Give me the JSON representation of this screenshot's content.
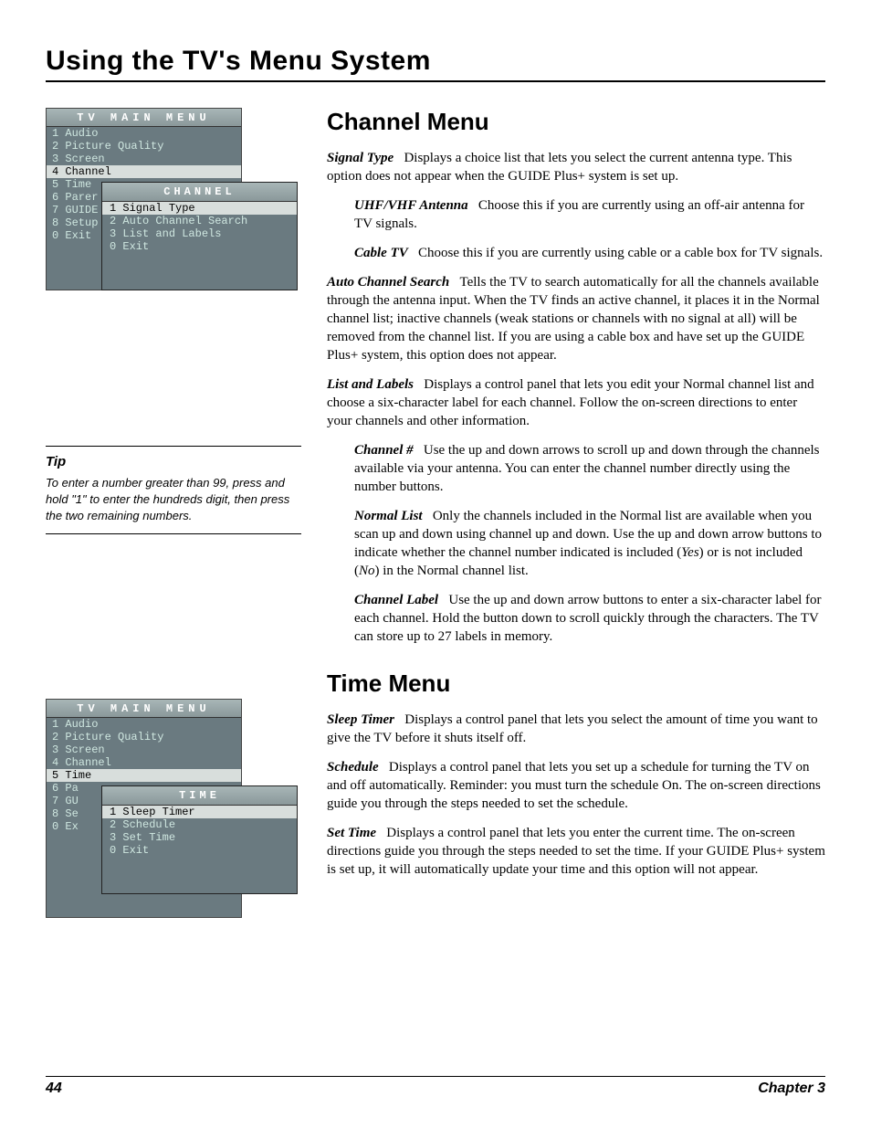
{
  "header": "Using the TV's Menu System",
  "footer": {
    "page": "44",
    "chapter": "Chapter 3"
  },
  "figure1": {
    "main_title": "TV MAIN MENU",
    "items": [
      {
        "n": "1",
        "l": "Audio"
      },
      {
        "n": "2",
        "l": "Picture Quality"
      },
      {
        "n": "3",
        "l": "Screen"
      },
      {
        "n": "4",
        "l": "Channel"
      },
      {
        "n": "5",
        "l": "Time"
      },
      {
        "n": "6",
        "l": "Parer"
      },
      {
        "n": "7",
        "l": "GUIDE"
      },
      {
        "n": "8",
        "l": "Setup"
      },
      {
        "n": "0",
        "l": "Exit"
      }
    ],
    "sub_title": "CHANNEL",
    "sub_items": [
      {
        "n": "1",
        "l": "Signal Type"
      },
      {
        "n": "2",
        "l": "Auto Channel Search"
      },
      {
        "n": "3",
        "l": "List and Labels"
      },
      {
        "n": "0",
        "l": "Exit"
      }
    ]
  },
  "tip": {
    "heading": "Tip",
    "text": "To enter a number greater than 99, press and hold \"1\" to enter the hundreds digit, then press the two remaining numbers."
  },
  "figure2": {
    "main_title": "TV MAIN MENU",
    "items": [
      {
        "n": "1",
        "l": "Audio"
      },
      {
        "n": "2",
        "l": "Picture Quality"
      },
      {
        "n": "3",
        "l": "Screen"
      },
      {
        "n": "4",
        "l": "Channel"
      },
      {
        "n": "5",
        "l": "Time"
      },
      {
        "n": "6",
        "l": "Pa"
      },
      {
        "n": "7",
        "l": "GU"
      },
      {
        "n": "8",
        "l": "Se"
      },
      {
        "n": "0",
        "l": "Ex"
      }
    ],
    "sub_title": "TIME",
    "sub_items": [
      {
        "n": "1",
        "l": "Sleep Timer"
      },
      {
        "n": "2",
        "l": "Schedule"
      },
      {
        "n": "3",
        "l": "Set Time"
      },
      {
        "n": "0",
        "l": "Exit"
      }
    ]
  },
  "channel_menu": {
    "title": "Channel Menu",
    "signal_type": {
      "term": "Signal Type",
      "text": "Displays a choice list that lets you select the current antenna type. This option does not appear when the GUIDE Plus+ system is set up."
    },
    "uhf": {
      "term": "UHF/VHF Antenna",
      "text": "Choose this if you are currently using an off-air antenna for TV signals."
    },
    "cable": {
      "term": "Cable TV",
      "text": "Choose this if you are currently using cable or a cable box for TV signals."
    },
    "auto": {
      "term": "Auto Channel Search",
      "text": "Tells the TV to search automatically for all the channels available through the antenna input. When the TV finds an active channel, it places it in the Normal channel list; inactive channels (weak stations or channels with no signal at all) will be removed from the channel list. If you are using a cable box and have set up the GUIDE Plus+ system, this option does not appear."
    },
    "list": {
      "term": "List and Labels",
      "text": "Displays a control panel that lets you edit your Normal channel list and choose a six-character label for each channel. Follow the on-screen directions to enter your channels and other information."
    },
    "channel_num": {
      "term": "Channel #",
      "text": "Use the up and down arrows to scroll up and down through the channels available via your antenna. You can enter the channel number directly using the number buttons."
    },
    "normal": {
      "term": "Normal List",
      "pre": "Only the channels included in the Normal list are available when you scan up and down using channel up and down. Use the up and down arrow buttons to indicate whether the channel number indicated is included (",
      "yes": "Yes",
      "mid": ") or is not included (",
      "no": "No",
      "post": ") in the Normal channel list."
    },
    "label": {
      "term": "Channel Label",
      "text": "Use the up and down arrow buttons to enter a six-character label for each channel. Hold the button down to scroll quickly through the characters. The TV can store up to 27 labels in memory."
    }
  },
  "time_menu": {
    "title": "Time Menu",
    "sleep": {
      "term": "Sleep Timer",
      "text": "Displays a control panel that lets you select the amount of time you want to give the TV before it shuts itself off."
    },
    "schedule": {
      "term": "Schedule",
      "text": "Displays a control panel that lets you set up a schedule for turning the TV on and off automatically. Reminder: you must turn the schedule On. The on-screen directions guide you through the steps needed to set the schedule."
    },
    "settime": {
      "term": "Set Time",
      "text": "Displays a control panel that lets you enter the current time. The on-screen directions guide you through the steps needed to set the time. If your GUIDE Plus+ system is set up, it will automatically update your time and this option will not appear."
    }
  }
}
